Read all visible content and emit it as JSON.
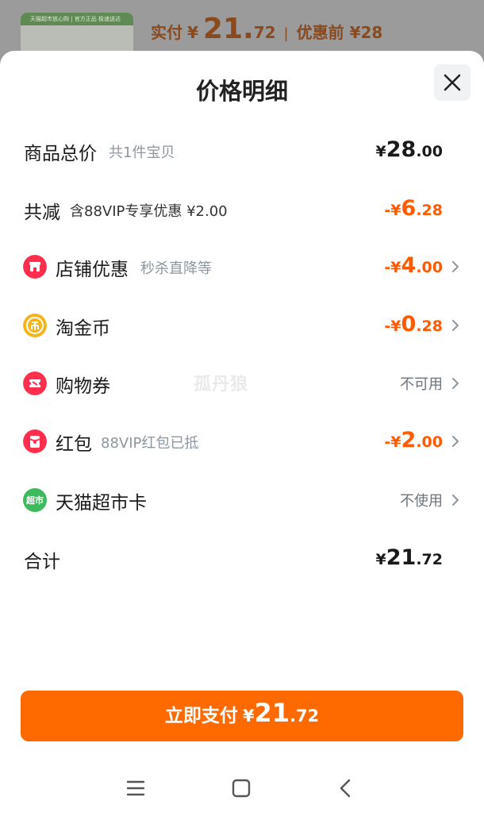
{
  "background": {
    "thumb_strip_text": "天猫超市放心购 | 官方正品 极速送达",
    "paid_label": "实付",
    "paid_yen": "¥",
    "paid_int": "21.",
    "paid_dec": "72",
    "separator": "|",
    "before_discount": "优惠前 ¥28"
  },
  "sheet": {
    "title": "价格明细",
    "watermark": "孤丹狼"
  },
  "rows": {
    "goods_total": {
      "label": "商品总价",
      "sub": "共1件宝贝",
      "yen": "¥",
      "int": "28",
      "dec": ".00"
    },
    "total_reduce": {
      "label": "共减",
      "sub": "含88VIP专享优惠 ¥2.00",
      "yen": "-¥",
      "int": "6",
      "dec": ".28"
    },
    "store_discount": {
      "label": "店铺优惠",
      "sub": "秒杀直降等",
      "yen": "-¥",
      "int": "4",
      "dec": ".00"
    },
    "taojinbi": {
      "label": "淘金币",
      "yen": "-¥",
      "int": "0",
      "dec": ".28"
    },
    "coupon": {
      "label": "购物券",
      "status": "不可用"
    },
    "redpacket": {
      "label": "红包",
      "sub": "88VIP红包已抵",
      "yen": "-¥",
      "int": "2",
      "dec": ".00"
    },
    "tmall_card": {
      "label": "天猫超市卡",
      "status": "不使用",
      "icon_text": "超市"
    },
    "sum": {
      "label": "合计",
      "yen": "¥",
      "int": "21",
      "dec": ".72"
    }
  },
  "pay_button": {
    "label": "立即支付",
    "yen": "¥",
    "int": "21",
    "dec": ".72"
  },
  "colors": {
    "accent": "#ff6a00",
    "discount_text": "#ff5a00",
    "store_icon": "#ff2e4d",
    "coin_icon": "#f7b31a",
    "tmall_icon": "#3dba5b"
  },
  "icons": {
    "close": "close-icon",
    "chevron": "chevron-right-icon",
    "nav_menu": "menu-icon",
    "nav_home": "home-square-icon",
    "nav_back": "back-arrow-icon"
  }
}
